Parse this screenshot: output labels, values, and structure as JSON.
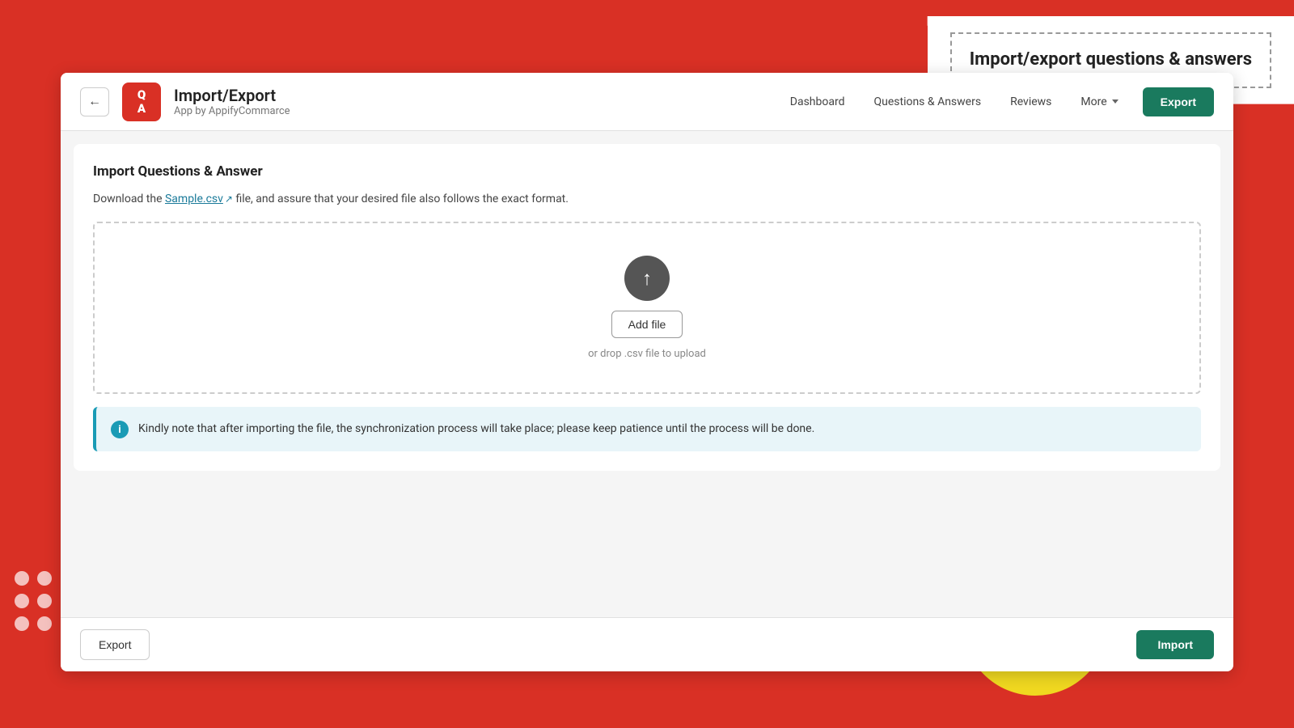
{
  "background": {
    "color": "#d93025"
  },
  "tooltip": {
    "title": "Import/export questions & answers"
  },
  "header": {
    "back_label": "←",
    "logo_text": "Q A",
    "app_title": "Import/Export",
    "app_subtitle": "App by AppifyCommarce",
    "nav": [
      {
        "label": "Dashboard",
        "id": "dashboard"
      },
      {
        "label": "Questions & Answers",
        "id": "qa"
      },
      {
        "label": "Reviews",
        "id": "reviews"
      },
      {
        "label": "More",
        "id": "more"
      }
    ],
    "export_button": "Export"
  },
  "main": {
    "section_title": "Import Questions & Answer",
    "info_text_before": "Download the ",
    "sample_link": "Sample.csv",
    "info_text_after": " file, and assure that your desired file also follows the exact format.",
    "upload": {
      "add_file_label": "Add file",
      "drop_hint": "or drop .csv file to upload"
    },
    "alert": {
      "message": "Kindly note that after importing the file, the synchronization process will take place; please keep patience until the process will be done."
    }
  },
  "footer": {
    "export_label": "Export",
    "import_label": "Import"
  }
}
